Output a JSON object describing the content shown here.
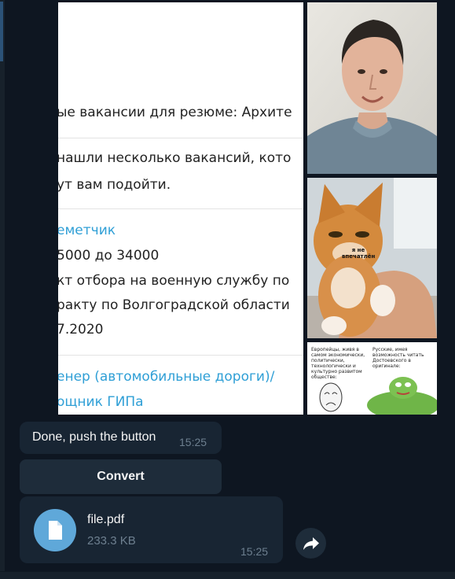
{
  "album": {
    "document": {
      "lines": [
        "ые вакансии для резюме: Архите",
        "нашли несколько вакансий, кото",
        "ут вам подойти.",
        "еметчик",
        "5000 до 34000",
        "кт отбора на военную службу по",
        "ракту по Волгоградской области",
        "7.2020",
        "енер (автомобильные дороги)/",
        "ощник ГИПа"
      ]
    },
    "cat_caption": "я не впечатлён",
    "meme": {
      "left_text": "Европейцы, живя в самом экономически, политически, технологически и культурно развитом обществе:",
      "right_text": "Русские, имея возможность читать Достоевского в оригинале:"
    }
  },
  "messages": {
    "text": "Done, push the button",
    "text_time": "15:25",
    "button_label": "Convert",
    "file": {
      "name": "file.pdf",
      "size": "233.3 KB",
      "time": "15:25"
    }
  },
  "colors": {
    "background": "#0e1621",
    "bubble": "#182533",
    "button": "#1e2c3a",
    "file_icon": "#5fa8d9",
    "link": "#2f9fd6",
    "timestamp": "#6d7f8f"
  },
  "icons": {
    "file": "file-icon",
    "forward": "forward-icon"
  }
}
